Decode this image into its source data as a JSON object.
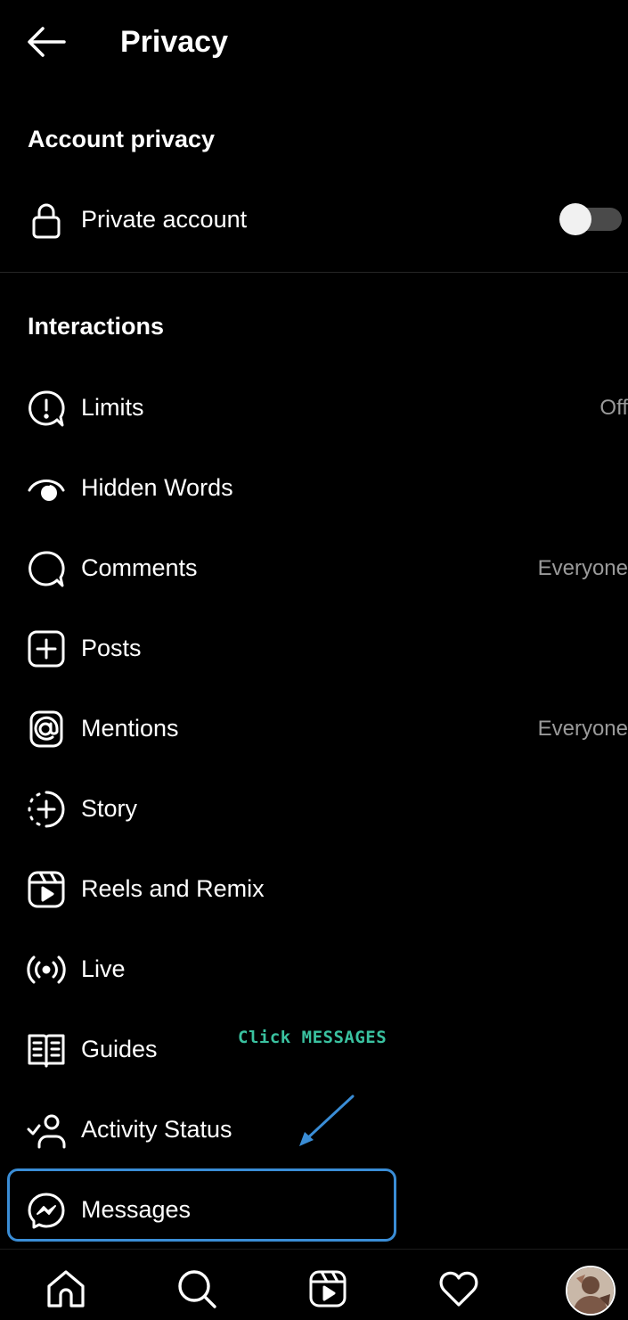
{
  "header": {
    "title": "Privacy",
    "back_icon": "arrow-left-icon"
  },
  "account_privacy": {
    "section_title": "Account privacy",
    "private_account": {
      "label": "Private account",
      "icon": "lock-icon",
      "enabled": false
    }
  },
  "interactions": {
    "section_title": "Interactions",
    "items": [
      {
        "label": "Limits",
        "value": "Off",
        "icon": "limits-icon"
      },
      {
        "label": "Hidden Words",
        "value": "",
        "icon": "hidden-words-icon"
      },
      {
        "label": "Comments",
        "value": "Everyone",
        "icon": "comment-icon"
      },
      {
        "label": "Posts",
        "value": "",
        "icon": "plus-square-icon"
      },
      {
        "label": "Mentions",
        "value": "Everyone",
        "icon": "at-sign-icon"
      },
      {
        "label": "Story",
        "value": "",
        "icon": "story-add-icon"
      },
      {
        "label": "Reels and Remix",
        "value": "",
        "icon": "reels-icon"
      },
      {
        "label": "Live",
        "value": "",
        "icon": "live-icon"
      },
      {
        "label": "Guides",
        "value": "",
        "icon": "guides-icon"
      },
      {
        "label": "Activity Status",
        "value": "",
        "icon": "activity-status-icon"
      },
      {
        "label": "Messages",
        "value": "",
        "icon": "messenger-icon"
      }
    ]
  },
  "annotation": {
    "text": "Click MESSAGES",
    "color": "#3ac2a0",
    "highlight_color": "#3a8dd6"
  },
  "bottom_nav": [
    "home-icon",
    "search-icon",
    "reels-icon",
    "heart-icon",
    "profile-avatar"
  ]
}
